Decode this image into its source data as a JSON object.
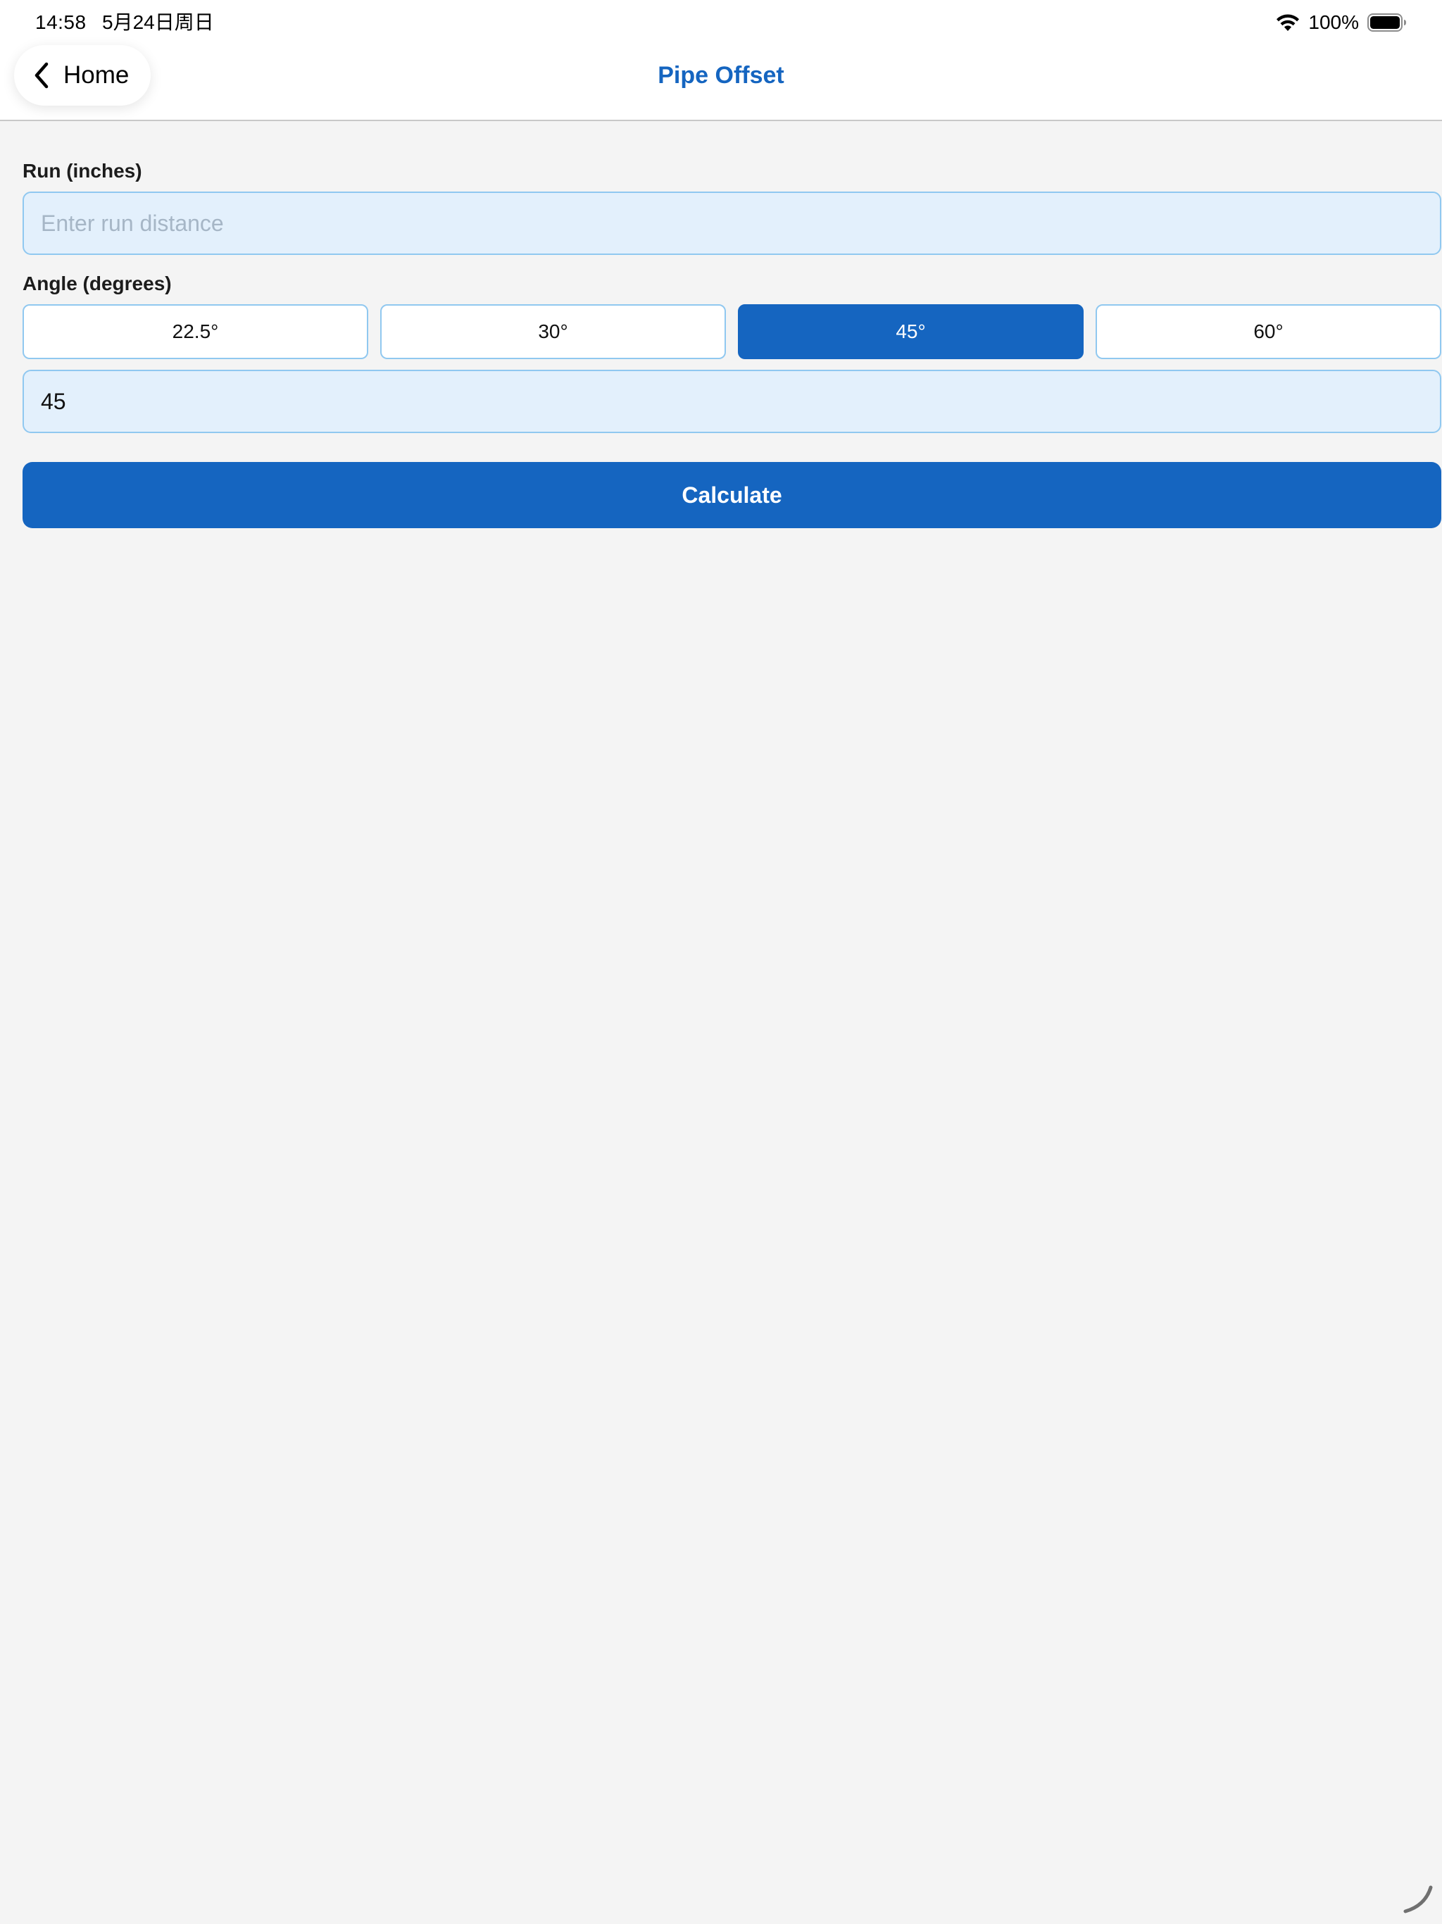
{
  "status_bar": {
    "time": "14:58",
    "date": "5月24日周日",
    "battery": "100%",
    "icons": [
      "wifi-icon",
      "battery-icon"
    ]
  },
  "nav": {
    "back_label": "Home",
    "back_icon": "chevron-left-icon",
    "title": "Pipe Offset"
  },
  "form": {
    "run": {
      "label": "Run (inches)",
      "value": "",
      "placeholder": "Enter run distance"
    },
    "angle": {
      "label": "Angle (degrees)",
      "options": [
        "22.5°",
        "30°",
        "45°",
        "60°"
      ],
      "selected": "45°",
      "value": "45"
    },
    "calculate_label": "Calculate"
  },
  "colors": {
    "accent": "#1565c0",
    "input_bg": "#e3f0fc",
    "input_border": "#90c8f0",
    "page_bg": "#f4f4f4"
  }
}
